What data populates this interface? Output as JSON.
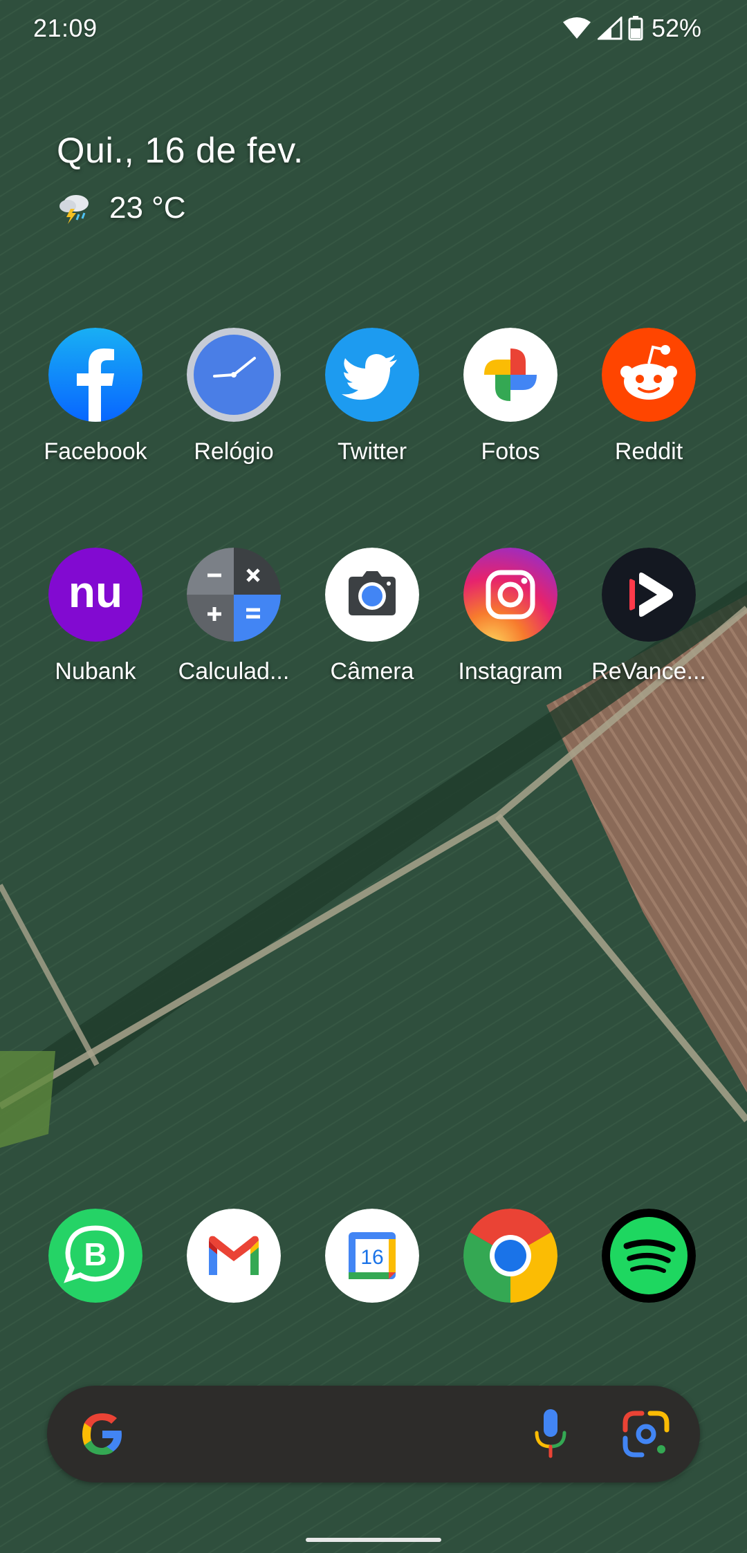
{
  "status_bar": {
    "time": "21:09",
    "battery_percent": "52%",
    "icons": [
      "wifi-icon",
      "cellular-signal-icon",
      "battery-icon"
    ]
  },
  "at_a_glance": {
    "date": "Qui., 16 de fev.",
    "weather_icon": "thunderstorm-rain-icon",
    "temperature": "23 °C"
  },
  "apps": {
    "row1": [
      {
        "label": "Facebook",
        "icon": "facebook-icon"
      },
      {
        "label": "Relógio",
        "icon": "clock-icon"
      },
      {
        "label": "Twitter",
        "icon": "twitter-icon"
      },
      {
        "label": "Fotos",
        "icon": "google-photos-icon"
      },
      {
        "label": "Reddit",
        "icon": "reddit-icon"
      }
    ],
    "row2": [
      {
        "label": "Nubank",
        "icon": "nubank-icon",
        "logo_text": "nu"
      },
      {
        "label": "Calculad...",
        "icon": "calculator-icon"
      },
      {
        "label": "Câmera",
        "icon": "camera-icon"
      },
      {
        "label": "Instagram",
        "icon": "instagram-icon"
      },
      {
        "label": "ReVance...",
        "icon": "revanced-icon"
      }
    ]
  },
  "dock": [
    {
      "icon": "whatsapp-business-icon"
    },
    {
      "icon": "gmail-icon"
    },
    {
      "icon": "google-calendar-icon",
      "day": "16"
    },
    {
      "icon": "chrome-icon"
    },
    {
      "icon": "spotify-icon"
    }
  ],
  "search_bar": {
    "icons": [
      "google-logo-icon",
      "microphone-icon",
      "google-lens-icon"
    ]
  },
  "colors": {
    "facebook": "#1877f2",
    "twitter": "#1d9bf0",
    "reddit": "#ff4500",
    "nubank": "#820ad1",
    "whatsapp_business": "#25d366",
    "spotify": "#1ed760",
    "search_bar_bg": "#2d2c2a"
  }
}
